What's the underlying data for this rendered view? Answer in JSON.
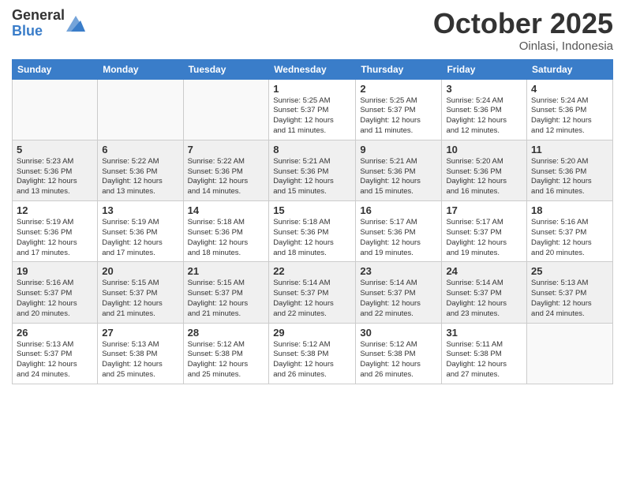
{
  "header": {
    "logo_general": "General",
    "logo_blue": "Blue",
    "month": "October 2025",
    "location": "Oinlasi, Indonesia"
  },
  "days_of_week": [
    "Sunday",
    "Monday",
    "Tuesday",
    "Wednesday",
    "Thursday",
    "Friday",
    "Saturday"
  ],
  "weeks": [
    [
      {
        "day": "",
        "info": ""
      },
      {
        "day": "",
        "info": ""
      },
      {
        "day": "",
        "info": ""
      },
      {
        "day": "1",
        "info": "Sunrise: 5:25 AM\nSunset: 5:37 PM\nDaylight: 12 hours\nand 11 minutes."
      },
      {
        "day": "2",
        "info": "Sunrise: 5:25 AM\nSunset: 5:37 PM\nDaylight: 12 hours\nand 11 minutes."
      },
      {
        "day": "3",
        "info": "Sunrise: 5:24 AM\nSunset: 5:36 PM\nDaylight: 12 hours\nand 12 minutes."
      },
      {
        "day": "4",
        "info": "Sunrise: 5:24 AM\nSunset: 5:36 PM\nDaylight: 12 hours\nand 12 minutes."
      }
    ],
    [
      {
        "day": "5",
        "info": "Sunrise: 5:23 AM\nSunset: 5:36 PM\nDaylight: 12 hours\nand 13 minutes."
      },
      {
        "day": "6",
        "info": "Sunrise: 5:22 AM\nSunset: 5:36 PM\nDaylight: 12 hours\nand 13 minutes."
      },
      {
        "day": "7",
        "info": "Sunrise: 5:22 AM\nSunset: 5:36 PM\nDaylight: 12 hours\nand 14 minutes."
      },
      {
        "day": "8",
        "info": "Sunrise: 5:21 AM\nSunset: 5:36 PM\nDaylight: 12 hours\nand 15 minutes."
      },
      {
        "day": "9",
        "info": "Sunrise: 5:21 AM\nSunset: 5:36 PM\nDaylight: 12 hours\nand 15 minutes."
      },
      {
        "day": "10",
        "info": "Sunrise: 5:20 AM\nSunset: 5:36 PM\nDaylight: 12 hours\nand 16 minutes."
      },
      {
        "day": "11",
        "info": "Sunrise: 5:20 AM\nSunset: 5:36 PM\nDaylight: 12 hours\nand 16 minutes."
      }
    ],
    [
      {
        "day": "12",
        "info": "Sunrise: 5:19 AM\nSunset: 5:36 PM\nDaylight: 12 hours\nand 17 minutes."
      },
      {
        "day": "13",
        "info": "Sunrise: 5:19 AM\nSunset: 5:36 PM\nDaylight: 12 hours\nand 17 minutes."
      },
      {
        "day": "14",
        "info": "Sunrise: 5:18 AM\nSunset: 5:36 PM\nDaylight: 12 hours\nand 18 minutes."
      },
      {
        "day": "15",
        "info": "Sunrise: 5:18 AM\nSunset: 5:36 PM\nDaylight: 12 hours\nand 18 minutes."
      },
      {
        "day": "16",
        "info": "Sunrise: 5:17 AM\nSunset: 5:36 PM\nDaylight: 12 hours\nand 19 minutes."
      },
      {
        "day": "17",
        "info": "Sunrise: 5:17 AM\nSunset: 5:37 PM\nDaylight: 12 hours\nand 19 minutes."
      },
      {
        "day": "18",
        "info": "Sunrise: 5:16 AM\nSunset: 5:37 PM\nDaylight: 12 hours\nand 20 minutes."
      }
    ],
    [
      {
        "day": "19",
        "info": "Sunrise: 5:16 AM\nSunset: 5:37 PM\nDaylight: 12 hours\nand 20 minutes."
      },
      {
        "day": "20",
        "info": "Sunrise: 5:15 AM\nSunset: 5:37 PM\nDaylight: 12 hours\nand 21 minutes."
      },
      {
        "day": "21",
        "info": "Sunrise: 5:15 AM\nSunset: 5:37 PM\nDaylight: 12 hours\nand 21 minutes."
      },
      {
        "day": "22",
        "info": "Sunrise: 5:14 AM\nSunset: 5:37 PM\nDaylight: 12 hours\nand 22 minutes."
      },
      {
        "day": "23",
        "info": "Sunrise: 5:14 AM\nSunset: 5:37 PM\nDaylight: 12 hours\nand 22 minutes."
      },
      {
        "day": "24",
        "info": "Sunrise: 5:14 AM\nSunset: 5:37 PM\nDaylight: 12 hours\nand 23 minutes."
      },
      {
        "day": "25",
        "info": "Sunrise: 5:13 AM\nSunset: 5:37 PM\nDaylight: 12 hours\nand 24 minutes."
      }
    ],
    [
      {
        "day": "26",
        "info": "Sunrise: 5:13 AM\nSunset: 5:37 PM\nDaylight: 12 hours\nand 24 minutes."
      },
      {
        "day": "27",
        "info": "Sunrise: 5:13 AM\nSunset: 5:38 PM\nDaylight: 12 hours\nand 25 minutes."
      },
      {
        "day": "28",
        "info": "Sunrise: 5:12 AM\nSunset: 5:38 PM\nDaylight: 12 hours\nand 25 minutes."
      },
      {
        "day": "29",
        "info": "Sunrise: 5:12 AM\nSunset: 5:38 PM\nDaylight: 12 hours\nand 26 minutes."
      },
      {
        "day": "30",
        "info": "Sunrise: 5:12 AM\nSunset: 5:38 PM\nDaylight: 12 hours\nand 26 minutes."
      },
      {
        "day": "31",
        "info": "Sunrise: 5:11 AM\nSunset: 5:38 PM\nDaylight: 12 hours\nand 27 minutes."
      },
      {
        "day": "",
        "info": ""
      }
    ]
  ]
}
